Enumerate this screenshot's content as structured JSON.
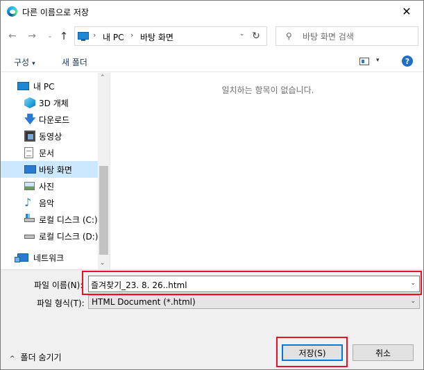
{
  "window": {
    "title": "다른 이름으로 저장",
    "close_glyph": "✕"
  },
  "nav": {
    "back_glyph": "←",
    "forward_glyph": "→",
    "recent_glyph": "⌄",
    "up_glyph": "↑",
    "breadcrumb": [
      "내 PC",
      "바탕 화면"
    ],
    "breadcrumb_sep": "›",
    "dropdown_glyph": "⌄",
    "refresh_glyph": "↻"
  },
  "search": {
    "placeholder": "바탕 화면 검색",
    "icon": "search-icon"
  },
  "toolbar": {
    "organize_label": "구성",
    "organize_caret": "▾",
    "new_folder_label": "새 폴더",
    "view_caret": "▾",
    "help_label": "?"
  },
  "sidebar": {
    "items": [
      {
        "label": "내 PC",
        "icon": "pc-icon",
        "selected": false
      },
      {
        "label": "3D 개체",
        "icon": "3d-objects-icon",
        "selected": false
      },
      {
        "label": "다운로드",
        "icon": "download-icon",
        "selected": false
      },
      {
        "label": "동영상",
        "icon": "video-icon",
        "selected": false
      },
      {
        "label": "문서",
        "icon": "document-icon",
        "selected": false
      },
      {
        "label": "바탕 화면",
        "icon": "desktop-icon",
        "selected": true
      },
      {
        "label": "사진",
        "icon": "pictures-icon",
        "selected": false
      },
      {
        "label": "음악",
        "icon": "music-icon",
        "selected": false
      },
      {
        "label": "로컬 디스크 (C:)",
        "icon": "drive-c-icon",
        "selected": false
      },
      {
        "label": "로컬 디스크 (D:)",
        "icon": "drive-d-icon",
        "selected": false
      },
      {
        "label": "네트워크",
        "icon": "network-icon",
        "selected": false
      }
    ],
    "scroll_up_glyph": "⌃",
    "scroll_down_glyph": "⌄"
  },
  "content": {
    "empty_message": "일치하는 항목이 없습니다."
  },
  "form": {
    "filename_label": "파일 이름(N):",
    "filename_value": "즐겨찾기_23. 8. 26..html",
    "filetype_label": "파일 형식(T):",
    "filetype_value": "HTML Document (*.html)",
    "caret_glyph": "⌄"
  },
  "footer": {
    "hide_folders_label": "폴더 숨기기",
    "hide_folders_caret": "^",
    "save_label": "저장(S)",
    "cancel_label": "취소"
  },
  "colors": {
    "accent": "#0078d7",
    "highlight_red": "#e81123",
    "selected_bg": "#cce8ff"
  }
}
